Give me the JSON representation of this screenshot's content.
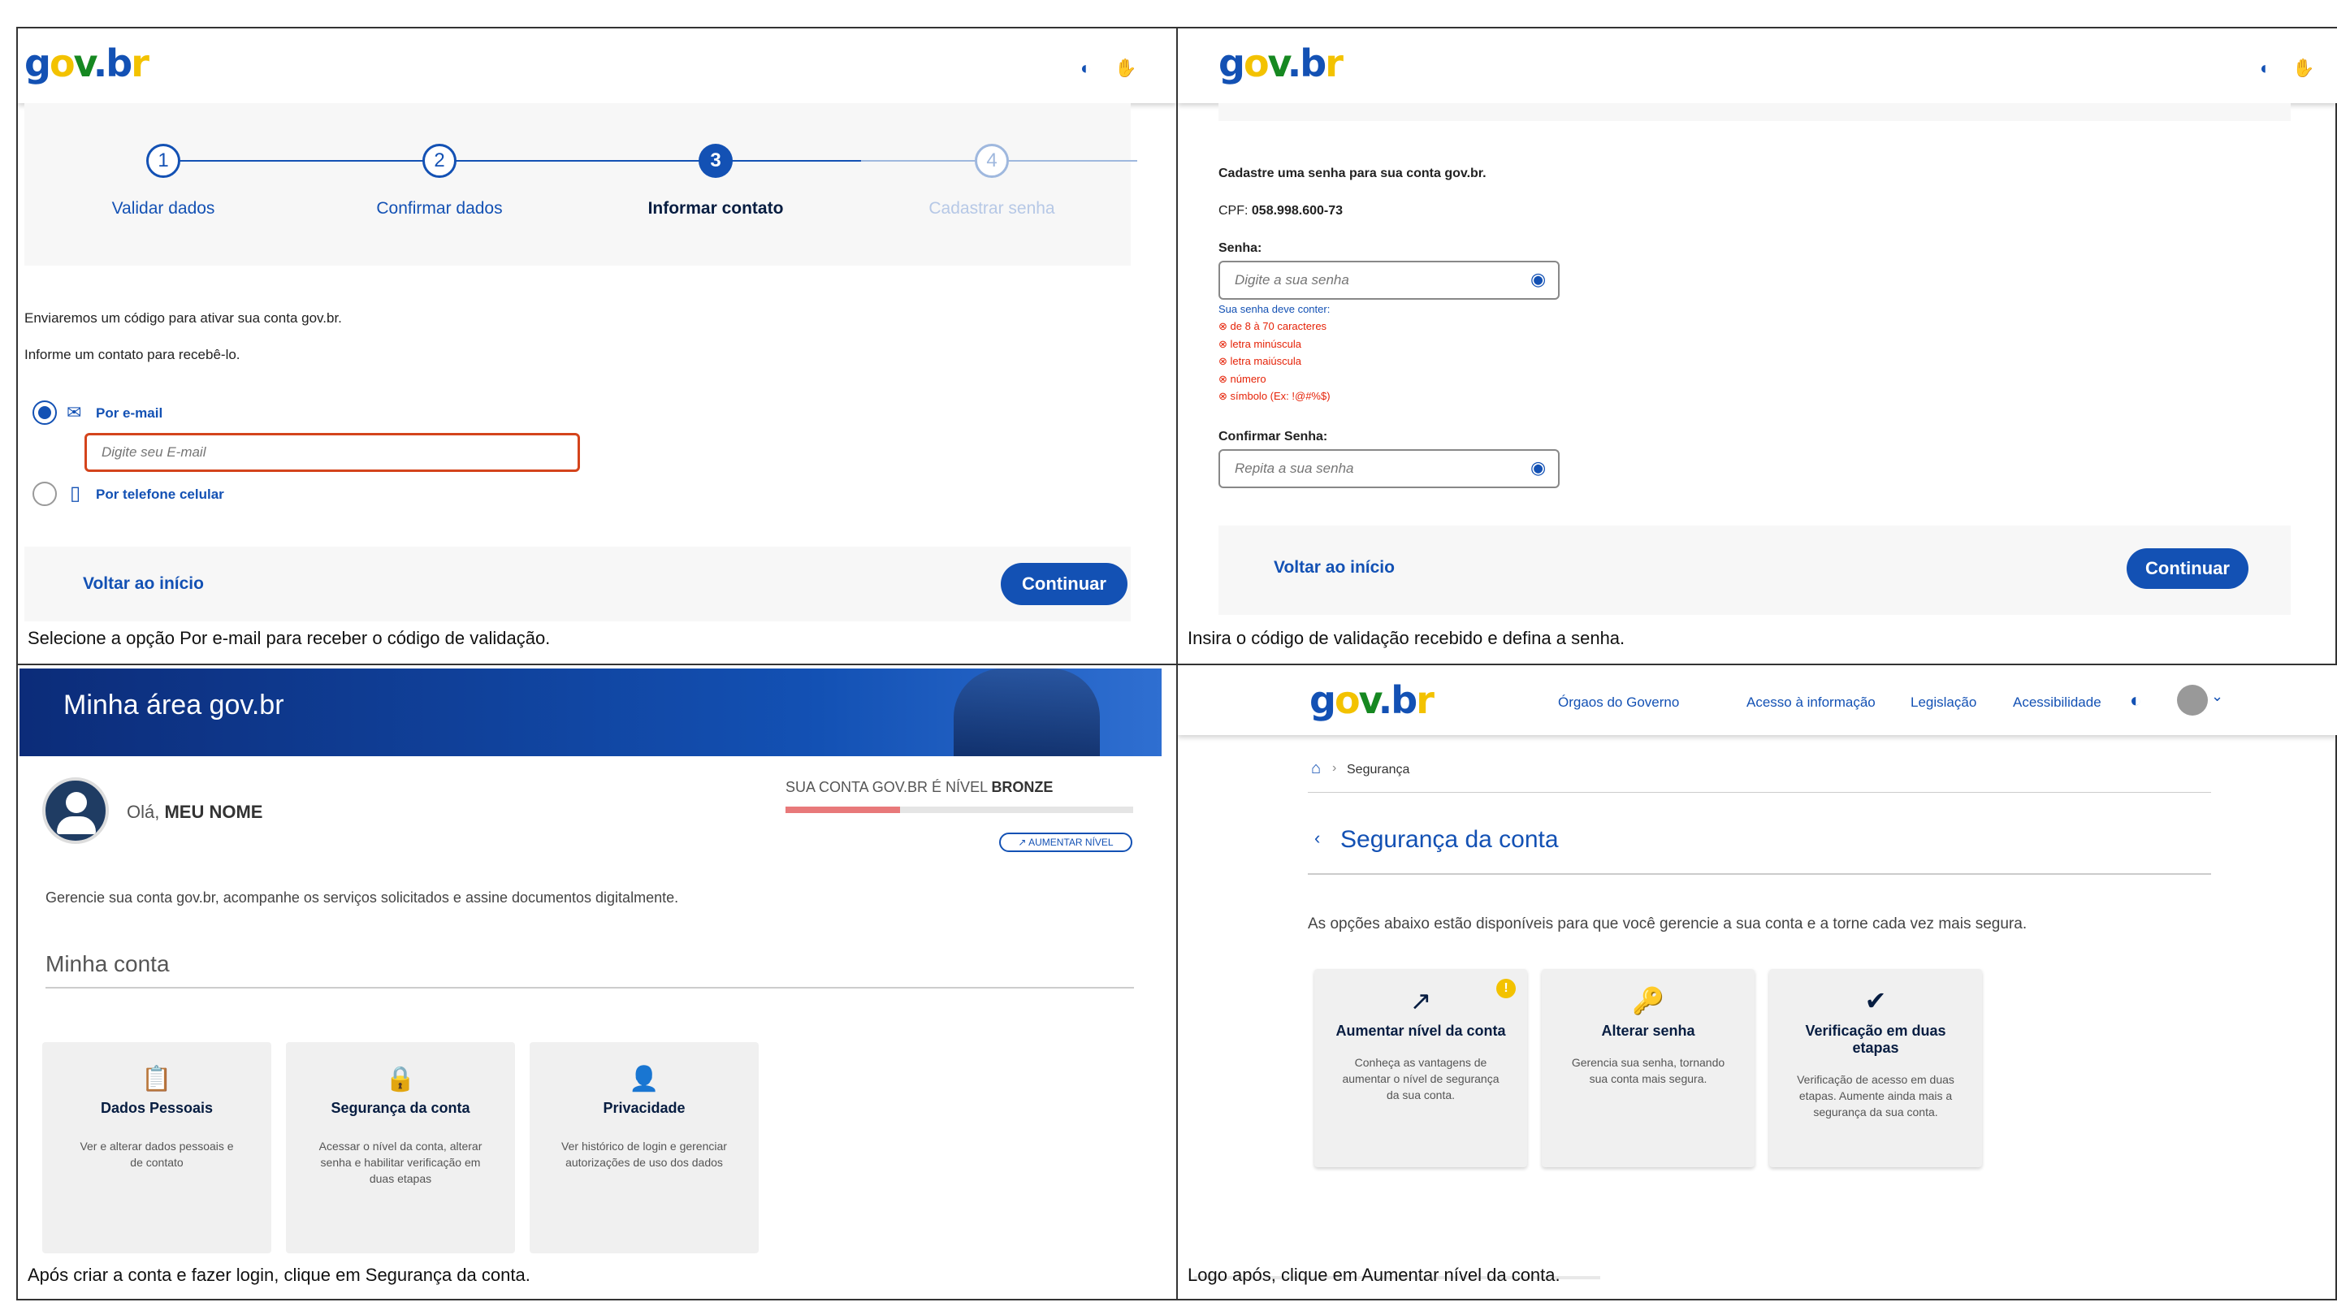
{
  "panel1": {
    "steps": [
      {
        "num": "1",
        "label": "Validar dados"
      },
      {
        "num": "2",
        "label": "Confirmar dados"
      },
      {
        "num": "3",
        "label": "Informar contato"
      },
      {
        "num": "4",
        "label": "Cadastrar senha"
      }
    ],
    "intro1": "Enviaremos um código para ativar sua conta gov.br.",
    "intro2": "Informe um contato para recebê-lo.",
    "email_option": "Por e-mail",
    "email_placeholder": "Digite seu E-mail",
    "phone_option": "Por telefone celular",
    "back": "Voltar ao início",
    "continue": "Continuar",
    "caption": "Selecione a opção Por e-mail para receber o código de validação."
  },
  "panel2": {
    "title": "Cadastre uma senha para sua conta gov.br.",
    "cpf_label": "CPF:",
    "cpf_value": "058.998.600-73",
    "senha_label": "Senha:",
    "senha_placeholder": "Digite a sua senha",
    "rules_title": "Sua senha deve conter:",
    "rules": [
      "de 8 à 70 caracteres",
      "letra minúscula",
      "letra maiúscula",
      "número",
      "símbolo (Ex: !@#%$)"
    ],
    "confirm_label": "Confirmar Senha:",
    "confirm_placeholder": "Repita a sua senha",
    "back": "Voltar ao início",
    "continue": "Continuar",
    "caption": "Insira o código de validação recebido e defina a senha."
  },
  "panel3": {
    "banner": "Minha área gov.br",
    "greeting": "Olá,",
    "name": "MEU NOME",
    "level_text": "SUA CONTA GOV.BR É NÍVEL",
    "level": "BRONZE",
    "level_progress": 0.33,
    "increase": "AUMENTAR NÍVEL",
    "desc": "Gerencie sua conta gov.br, acompanhe os serviços solicitados e assine documentos digitalmente.",
    "section": "Minha conta",
    "cards": [
      {
        "title": "Dados Pessoais",
        "desc": "Ver e alterar dados pessoais e de contato"
      },
      {
        "title": "Segurança da conta",
        "desc": "Acessar o nível da conta, alterar senha e habilitar verificação em duas etapas"
      },
      {
        "title": "Privacidade",
        "desc": "Ver histórico de login e gerenciar autorizações de uso dos dados"
      }
    ],
    "caption": "Após criar a conta e fazer login, clique em Segurança da conta."
  },
  "panel4": {
    "nav": [
      "Órgaos do Governo",
      "Acesso à informação",
      "Legislação",
      "Acessibilidade"
    ],
    "breadcrumb": "Segurança",
    "title": "Segurança da conta",
    "desc": "As opções abaixo estão disponíveis para que você gerencie a sua conta e a torne cada vez mais segura.",
    "cards": [
      {
        "title": "Aumentar nível da conta",
        "desc": "Conheça as vantagens de aumentar o nível de segurança da sua conta."
      },
      {
        "title": "Alterar senha",
        "desc": "Gerencia sua senha, tornando sua conta mais segura."
      },
      {
        "title": "Verificação em duas etapas",
        "desc": "Verificação de acesso em duas etapas. Aumente ainda mais a segurança da sua conta."
      }
    ],
    "caption": "Logo após, clique em Aumentar nível da conta."
  },
  "logo": {
    "p1": "g",
    "p2": "o",
    "p3": "v",
    "p4": ".",
    "p5": "b",
    "p6": "r"
  },
  "colors": {
    "primary": "#1351b4",
    "error": "#e52207",
    "warning": "#f3c200"
  }
}
